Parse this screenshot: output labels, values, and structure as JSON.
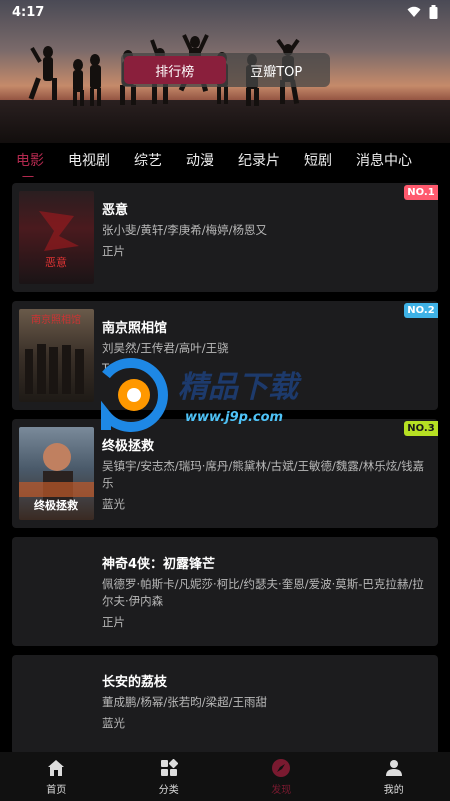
{
  "status": {
    "time": "4:17"
  },
  "header": {
    "toggle": [
      {
        "label": "排行榜",
        "active": true
      },
      {
        "label": "豆瓣TOP",
        "active": false
      }
    ]
  },
  "tabs": [
    "电影",
    "电视剧",
    "综艺",
    "动漫",
    "纪录片",
    "短剧",
    "消息中心"
  ],
  "items": [
    {
      "title": "恶意",
      "cast": "张小斐/黄轩/李庚希/梅婷/杨恩又",
      "type": "正片",
      "rank": "NO.1",
      "rank_color": "#ff5a6e"
    },
    {
      "title": "南京照相馆",
      "cast": "刘昊然/王传君/高叶/王骁",
      "type": "TC",
      "rank": "NO.2",
      "rank_color": "#3fb2e6"
    },
    {
      "title": "终极拯救",
      "cast": "吴镇宇/安志杰/瑞玛·席丹/熊黛林/古斌/王敏德/魏露/林乐炫/钱嘉乐",
      "type": "蓝光",
      "rank": "NO.3",
      "rank_color": "#b6e023"
    },
    {
      "title": "神奇4侠：初露锋芒",
      "cast": "佩德罗·帕斯卡/凡妮莎·柯比/约瑟夫·奎恩/爱波·莫斯-巴克拉赫/拉尔夫·伊内森",
      "type": "正片"
    },
    {
      "title": "长安的荔枝",
      "cast": "董成鹏/杨幂/张若昀/梁超/王雨甜",
      "type": "蓝光"
    }
  ],
  "posters": [
    {
      "text": "恶意"
    },
    {
      "text": "南京照相馆"
    },
    {
      "text": "终极拯救"
    }
  ],
  "watermark": {
    "brand": "精品下载",
    "url": "www.j9p.com"
  },
  "nav": [
    {
      "label": "首页",
      "icon": "home-icon"
    },
    {
      "label": "分类",
      "icon": "category-icon"
    },
    {
      "label": "发现",
      "icon": "compass-icon",
      "active": true
    },
    {
      "label": "我的",
      "icon": "user-icon"
    }
  ]
}
